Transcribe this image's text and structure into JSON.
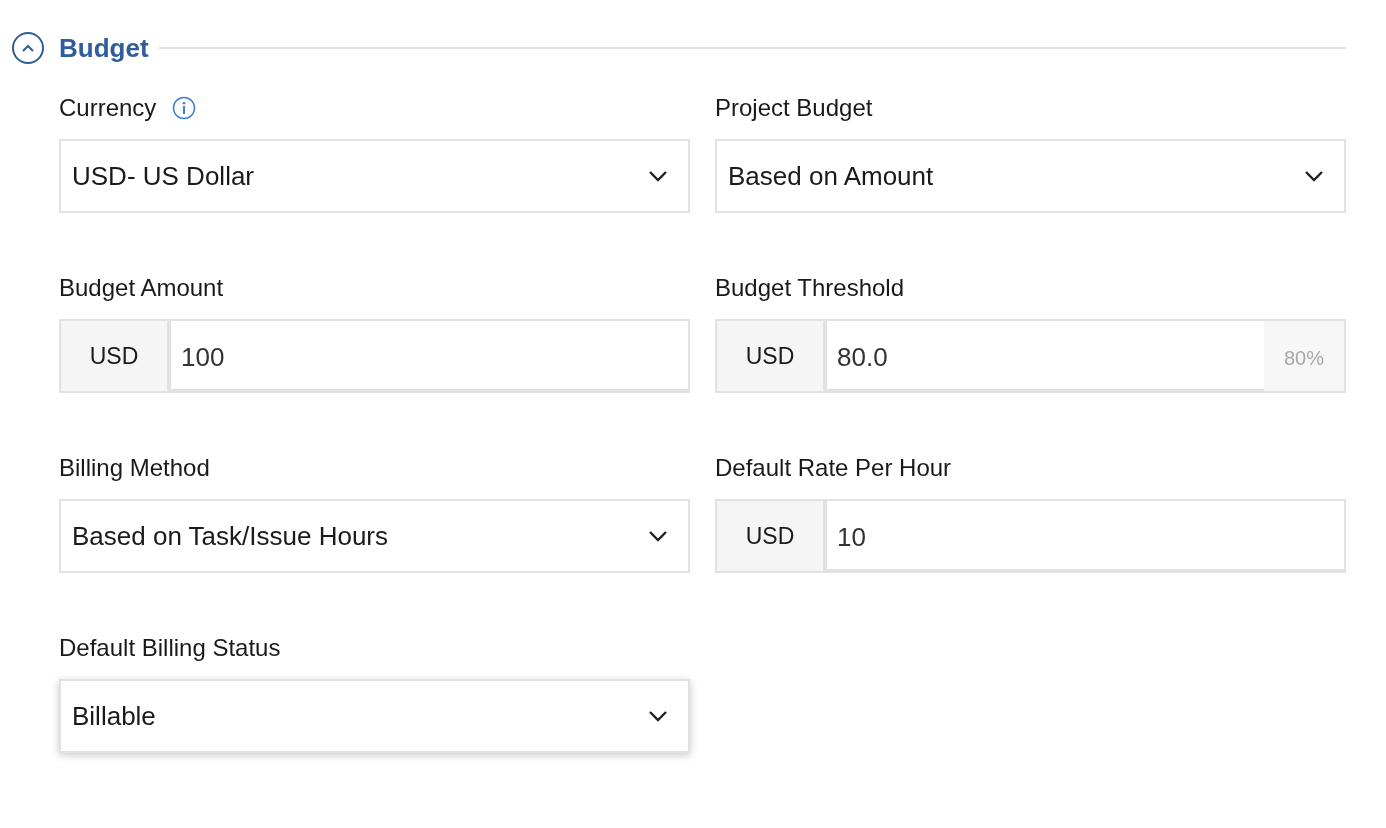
{
  "section": {
    "title": "Budget",
    "expanded": true
  },
  "fields": [
    {
      "label": "Currency",
      "info": true,
      "kind": "select",
      "value": "USD- US Dollar",
      "focused": false
    },
    {
      "label": "Project Budget",
      "info": false,
      "kind": "select",
      "value": "Based on Amount",
      "focused": false
    },
    {
      "label": "Budget Amount",
      "info": false,
      "kind": "prefixed",
      "prefix": "USD",
      "value": "100",
      "focused": false
    },
    {
      "label": "Budget Threshold",
      "info": false,
      "kind": "prefixed",
      "prefix": "USD",
      "value": "80.0",
      "suffix": "80%",
      "focused": false
    },
    {
      "label": "Billing Method",
      "info": false,
      "kind": "select",
      "value": "Based on Task/Issue Hours",
      "focused": false
    },
    {
      "label": "Default Rate Per Hour",
      "info": false,
      "kind": "prefixed",
      "prefix": "USD",
      "value": "10",
      "focused": false
    },
    {
      "label": "Default Billing Status",
      "info": false,
      "kind": "select",
      "value": "Billable",
      "focused": true
    }
  ]
}
